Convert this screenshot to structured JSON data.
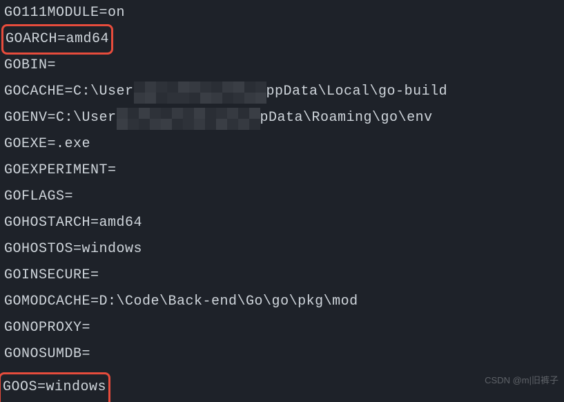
{
  "env": {
    "go111module": "GO111MODULE=on",
    "goarch": "GOARCH=amd64",
    "gobin": "GOBIN=",
    "gocache_prefix": "GOCACHE=C:\\User",
    "gocache_suffix": "ppData\\Local\\go-build",
    "goenv_prefix": "GOENV=C:\\User",
    "goenv_suffix": "pData\\Roaming\\go\\env",
    "goexe": "GOEXE=.exe",
    "goexperiment": "GOEXPERIMENT=",
    "goflags": "GOFLAGS=",
    "gohostarch": "GOHOSTARCH=amd64",
    "gohostos": "GOHOSTOS=windows",
    "goinsecure": "GOINSECURE=",
    "gomodcache": "GOMODCACHE=D:\\Code\\Back-end\\Go\\go\\pkg\\mod",
    "gonoproxy": "GONOPROXY=",
    "gonosumdb": "GONOSUMDB=",
    "goos": "GOOS=windows"
  },
  "watermark": "CSDN @m|旧裤子"
}
